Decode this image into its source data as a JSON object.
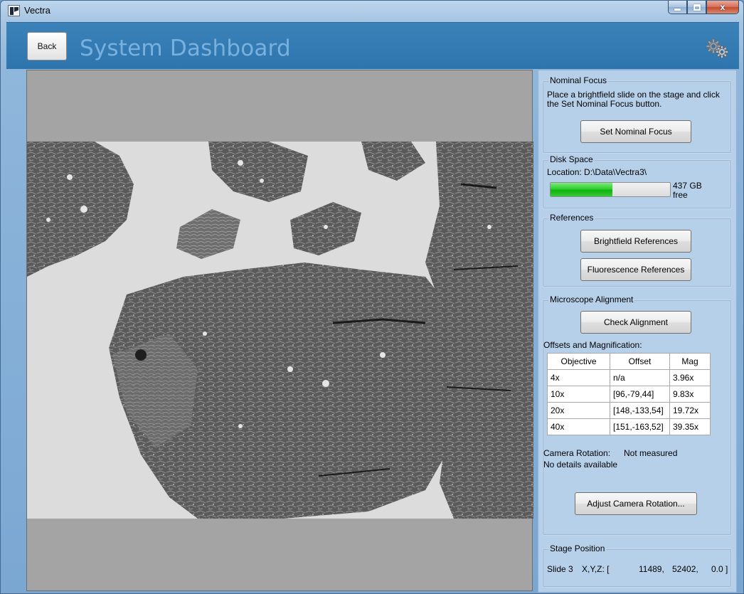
{
  "window": {
    "title": "Vectra",
    "minimize_icon": "minimize-icon",
    "maximize_icon": "maximize-icon",
    "close_glyph": "x"
  },
  "header": {
    "back_label": "Back",
    "title": "System Dashboard",
    "settings_icon": "gears-icon"
  },
  "nominal_focus": {
    "legend": "Nominal Focus",
    "instruction": "Place a brightfield slide on the stage and click the Set Nominal Focus button.",
    "button_label": "Set Nominal Focus"
  },
  "disk_space": {
    "legend": "Disk Space",
    "location": "Location: D:\\Data\\Vectra3\\",
    "free_amount": "437 GB",
    "free_label": "free",
    "used_fraction": 0.52
  },
  "references": {
    "legend": "References",
    "brightfield_label": "Brightfield References",
    "fluorescence_label": "Fluorescence References"
  },
  "alignment": {
    "legend": "Microscope Alignment",
    "check_label": "Check Alignment",
    "offsets_heading": "Offsets and Magnification:",
    "columns": [
      "Objective",
      "Offset",
      "Mag"
    ],
    "rows": [
      [
        "4x",
        "n/a",
        "3.96x"
      ],
      [
        "10x",
        "[96,-79,44]",
        "9.83x"
      ],
      [
        "20x",
        "[148,-133,54]",
        "19.72x"
      ],
      [
        "40x",
        "[151,-163,52]",
        "39.35x"
      ]
    ],
    "camera_rotation_label": "Camera Rotation:",
    "camera_rotation_value": "Not measured",
    "details": "No details available",
    "adjust_label": "Adjust Camera Rotation..."
  },
  "stage": {
    "legend": "Stage Position",
    "slide": "Slide 3",
    "xyz_label": "X,Y,Z: [",
    "x": "11489,",
    "y": "52402,",
    "z": "0.0 ]"
  },
  "colors": {
    "header_blue": "#2e75ad",
    "title_text": "#79b1de",
    "panel": "#b7d0ea",
    "progress_green": "#2fcf2f"
  }
}
